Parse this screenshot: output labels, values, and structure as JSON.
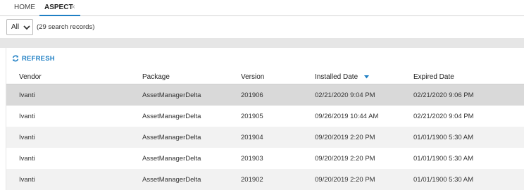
{
  "tabs": [
    {
      "label": "HOME"
    },
    {
      "label": "ASPECT",
      "close": "×"
    }
  ],
  "filter": {
    "selected": "All",
    "records_text": "(29 search records)"
  },
  "toolbar": {
    "refresh_label": "REFRESH"
  },
  "table": {
    "columns": [
      "Vendor",
      "Package",
      "Version",
      "Installed Date",
      "Expired Date"
    ],
    "sorted_column": "Installed Date",
    "sort_direction": "descending",
    "rows": [
      [
        "Ivanti",
        "AssetManagerDelta",
        "201906",
        "02/21/2020 9:04 PM",
        "02/21/2020 9:06 PM"
      ],
      [
        "Ivanti",
        "AssetManagerDelta",
        "201905",
        "09/26/2019 10:44 AM",
        "02/21/2020 9:04 PM"
      ],
      [
        "Ivanti",
        "AssetManagerDelta",
        "201904",
        "09/20/2019 2:20 PM",
        "01/01/1900 5:30 AM"
      ],
      [
        "Ivanti",
        "AssetManagerDelta",
        "201903",
        "09/20/2019 2:20 PM",
        "01/01/1900 5:30 AM"
      ],
      [
        "Ivanti",
        "AssetManagerDelta",
        "201902",
        "09/20/2019 2:20 PM",
        "01/01/1900 5:30 AM"
      ]
    ]
  },
  "colors": {
    "accent": "#1f7fc4",
    "selected_row": "#d9d9d9",
    "alt_row": "#f2f2f2"
  }
}
